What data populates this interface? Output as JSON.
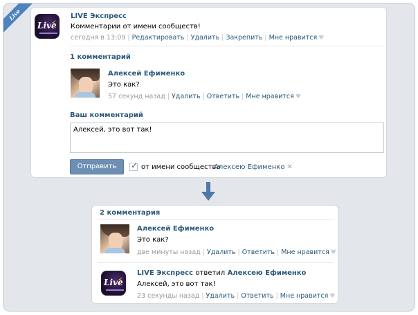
{
  "ribbon": {
    "label": "Live"
  },
  "post": {
    "author": "LIVE Экспресс",
    "text": "Комментарии от имени сообществ!",
    "time": "сегодня в 13:09",
    "actions": [
      "Редактировать",
      "Удалить",
      "Закрепить",
      "Мне нравится"
    ],
    "avatar_text": "Live",
    "heart_icon": "heart-icon"
  },
  "comments_top": {
    "count_label": "1 комментарий",
    "comment": {
      "author": "Алексей Ефименко",
      "text": "Это как?",
      "time": "57 секунд назад",
      "actions": [
        "Удалить",
        "Ответить",
        "Мне нравится"
      ]
    }
  },
  "reply_form": {
    "title": "Ваш комментарий",
    "value": "Алексей, это вот так!",
    "send_label": "Отправить",
    "checkbox_checked": true,
    "checkbox_label": "от имени сообщества",
    "reply_to": "Алексею Ефименко",
    "reply_to_close": "✕"
  },
  "arrow": {
    "icon": "arrow-down-icon",
    "color": "#4f78a6"
  },
  "comments_bottom": {
    "count_label": "2 комментария",
    "first": {
      "author": "Алексей Ефименко",
      "text": "Это как?",
      "time": "две минуты назад",
      "actions": [
        "Удалить",
        "Ответить",
        "Мне нравится"
      ]
    },
    "second": {
      "author": "LIVE Экспресс",
      "replied_word": "ответил",
      "replied_to": "Алексею Ефименко",
      "text": "Алексей, это вот так!",
      "time": "23 секунды назад",
      "actions": [
        "Удалить",
        "Ответить",
        "Мне нравится"
      ],
      "avatar_text": "Live"
    }
  },
  "colors": {
    "link": "#2b587a",
    "meta": "#999999",
    "button": "#6d8fb3",
    "frame": "#e3e6ea"
  }
}
